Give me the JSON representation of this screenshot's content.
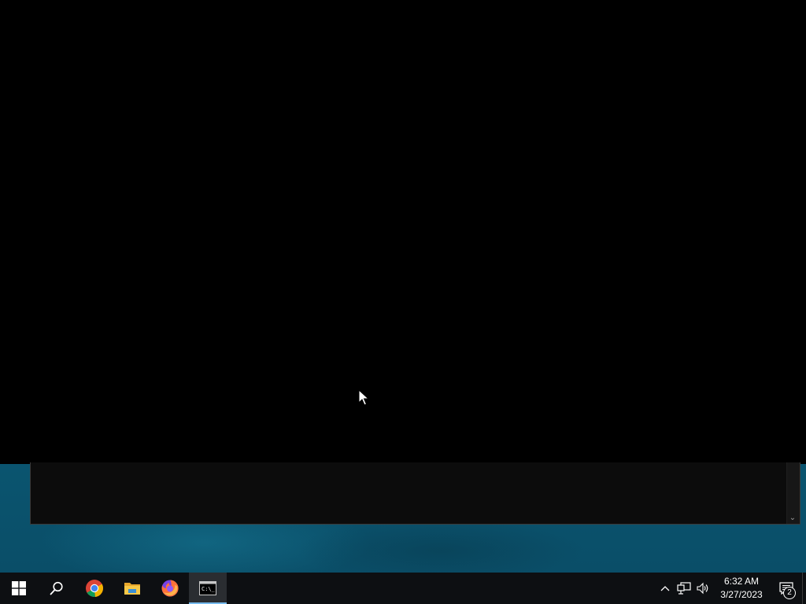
{
  "taskbar": {
    "apps": [
      {
        "name": "Start",
        "icon": "windows-logo-icon"
      },
      {
        "name": "Search",
        "icon": "search-icon"
      },
      {
        "name": "Google Chrome",
        "icon": "chrome-icon"
      },
      {
        "name": "File Explorer",
        "icon": "folder-icon"
      },
      {
        "name": "Firefox",
        "icon": "firefox-icon"
      },
      {
        "name": "Command Prompt",
        "icon": "cmd-icon",
        "active": true
      }
    ],
    "tray": {
      "time": "6:32 AM",
      "date": "3/27/2023",
      "notification_count": "2"
    }
  },
  "colors": {
    "taskbar_bg": "#0d0f12",
    "active_indicator": "#76b9ed",
    "wallpaper": "#0b5f7b",
    "console_bg": "#0c0c0c"
  }
}
